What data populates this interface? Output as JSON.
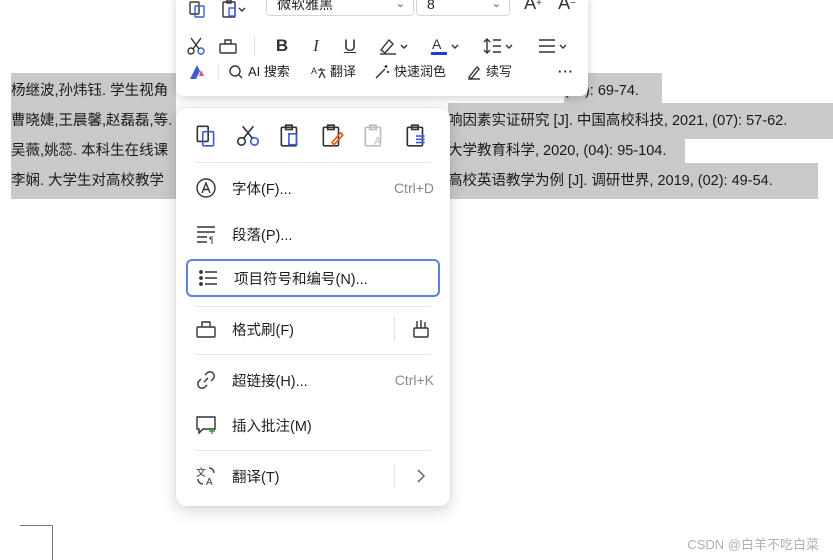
{
  "document": {
    "lines": [
      {
        "a": "杨继波,孙炜钰. 学生视角",
        "b": "(10): 69-74."
      },
      {
        "a": "曹晓婕,王晨馨,赵磊磊,等.",
        "b": "响因素实证研究 [J]. 中国高校科技, 2021, (07): 57-62."
      },
      {
        "a": "吴薇,姚蕊. 本科生在线课",
        "b": "大学教育科学, 2020, (04): 95-104."
      },
      {
        "a": "李娴. 大学生对高校教学",
        "b": "高校英语教学为例 [J]. 调研世界, 2019, (02): 49-54."
      }
    ]
  },
  "toolbar": {
    "font_name": "微软雅黑",
    "font_size": "8",
    "ai_search": "AI 搜索",
    "translate": "翻译",
    "quick_polish": "快速润色",
    "continue_write": "续写",
    "more": "···",
    "colors": {
      "font_color": "#1a3fd1",
      "brand": "#3b5bdb"
    }
  },
  "menu": {
    "quick_actions": [
      "copy",
      "cut",
      "paste-keep-format",
      "paste-match-format",
      "paste-text-only",
      "paste-special"
    ],
    "items": [
      {
        "label": "字体(F)...",
        "shortcut": "Ctrl+D"
      },
      {
        "label": "段落(P)..."
      },
      {
        "label": "项目符号和编号(N)..."
      },
      {
        "label": "格式刷(F)"
      },
      {
        "label": "超链接(H)...",
        "shortcut": "Ctrl+K"
      },
      {
        "label": "插入批注(M)"
      },
      {
        "label": "翻译(T)"
      }
    ]
  },
  "watermark": "CSDN @白羊不吃白菜"
}
